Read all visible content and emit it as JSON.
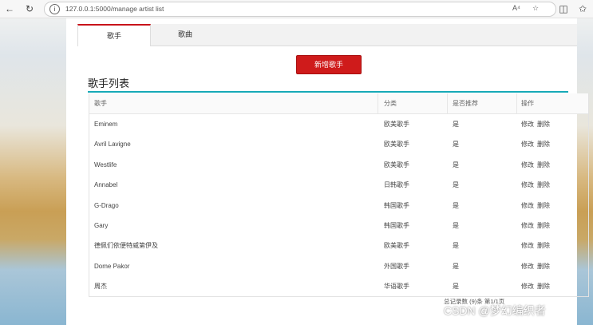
{
  "browser": {
    "url": "127.0.0.1:5000/manage artist list",
    "reader_label": "A⁴"
  },
  "tabs": [
    {
      "label": "歌手"
    },
    {
      "label": "歌曲"
    }
  ],
  "add_button": "新增歌手",
  "list_title": "歌手列表",
  "table": {
    "headers": [
      "歌手",
      "分类",
      "是否推荐",
      "操作"
    ],
    "edit_label": "修改",
    "delete_label": "删除",
    "rows": [
      {
        "name": "Eminem",
        "category": "欧美歌手",
        "recommended": "是"
      },
      {
        "name": "Avril Lavigne",
        "category": "欧美歌手",
        "recommended": "是"
      },
      {
        "name": "Westlife",
        "category": "欧美歌手",
        "recommended": "是"
      },
      {
        "name": "Annabel",
        "category": "日韩歌手",
        "recommended": "是"
      },
      {
        "name": "G-Drago",
        "category": "韩国歌手",
        "recommended": "是"
      },
      {
        "name": "Gary",
        "category": "韩国歌手",
        "recommended": "是"
      },
      {
        "name": "德佩们依便特威第伊及",
        "category": "欧美歌手",
        "recommended": "是"
      },
      {
        "name": "Dome Pakor",
        "category": "外国歌手",
        "recommended": "是"
      },
      {
        "name": "周杰",
        "category": "华语歌手",
        "recommended": "是"
      }
    ]
  },
  "footer_text": "总记录数 (9)条 第1/1页",
  "watermark": "CSDN @梦幻编织者"
}
